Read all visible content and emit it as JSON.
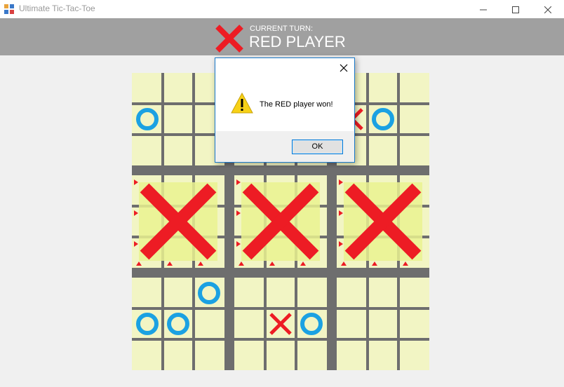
{
  "window": {
    "title": "Ultimate Tic-Tac-Toe",
    "minimize_glyph": "—",
    "maximize_glyph": "☐",
    "close_glyph": "✕"
  },
  "header": {
    "turn_label": "CURRENT TURN:",
    "turn_player": "RED PLAYER",
    "turn_icon": "red-x-icon"
  },
  "dialog": {
    "message": "The RED player won!",
    "ok_label": "OK",
    "icon": "warning-icon"
  },
  "colors": {
    "red": "#ed1c24",
    "blue": "#1ba1e2",
    "cell": "#f2f5c4",
    "highlight": "#eaf290",
    "grid_line": "#6e6e6e",
    "header_bg": "#a0a0a0"
  },
  "board": {
    "won_subboards": [
      3,
      4,
      5
    ],
    "subboard_winners": {
      "3": "X",
      "4": "X",
      "5": "X"
    },
    "marks": [
      {
        "sb": 0,
        "cell": 3,
        "mark": "O"
      },
      {
        "sb": 2,
        "cell": 3,
        "mark": "X"
      },
      {
        "sb": 2,
        "cell": 4,
        "mark": "O"
      },
      {
        "sb": 6,
        "cell": 2,
        "mark": "O"
      },
      {
        "sb": 6,
        "cell": 3,
        "mark": "O"
      },
      {
        "sb": 6,
        "cell": 4,
        "mark": "O"
      },
      {
        "sb": 7,
        "cell": 4,
        "mark": "X"
      },
      {
        "sb": 7,
        "cell": 5,
        "mark": "O"
      }
    ]
  }
}
